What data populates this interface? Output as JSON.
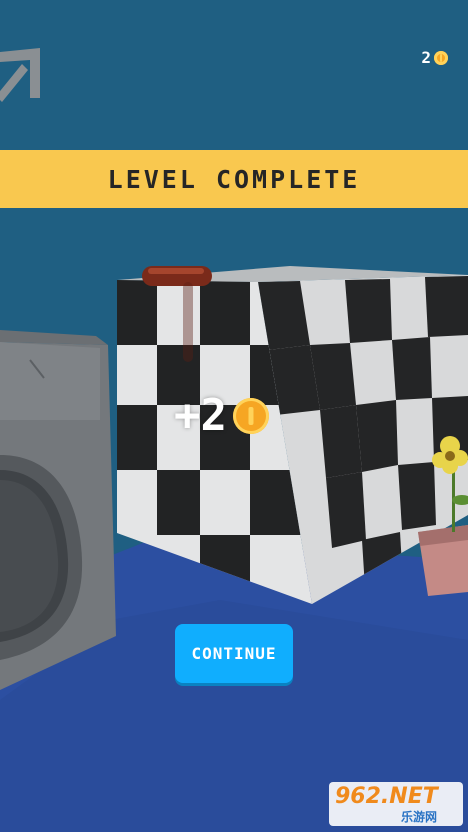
{
  "hud": {
    "coins": "2",
    "coin_icon": "coin-icon",
    "share_icon": "share-arrow-icon"
  },
  "banner": {
    "text": "LEVEL COMPLETE"
  },
  "reward": {
    "text": "+2",
    "icon": "coin-icon"
  },
  "continue_button": {
    "label": "CONTINUE"
  },
  "watermark": {
    "main": "962.NET",
    "sub": "乐游网"
  },
  "colors": {
    "background": "#1f5f82",
    "floor": "#2c4fa1",
    "banner": "#f9c84f",
    "button": "#10aefe",
    "coin": "#f6a623"
  }
}
